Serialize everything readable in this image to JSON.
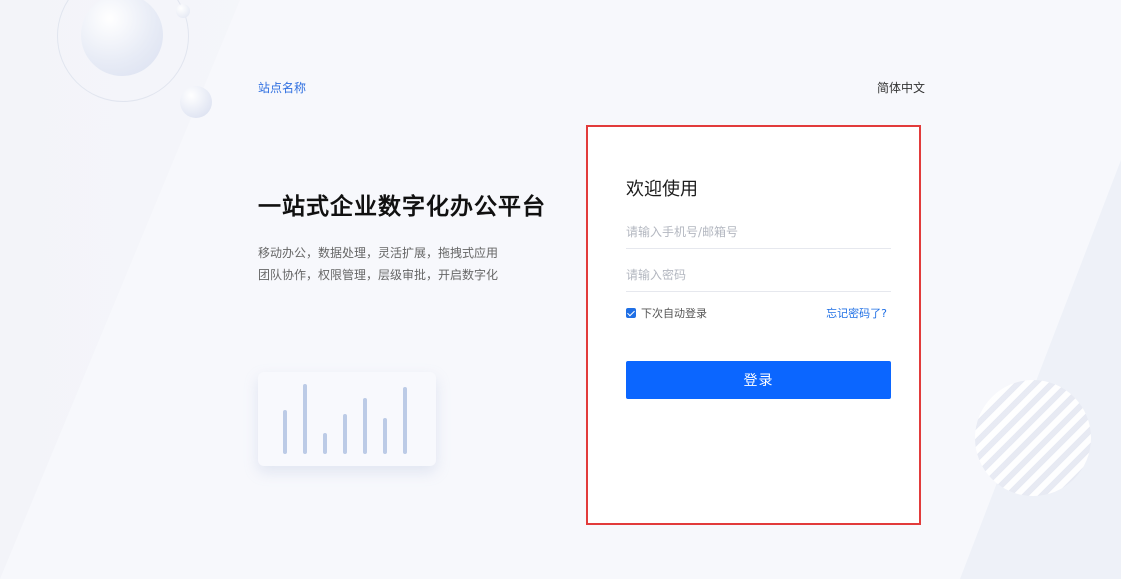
{
  "header": {
    "site_name": "站点名称",
    "language": "简体中文"
  },
  "hero": {
    "title": "一站式企业数字化办公平台",
    "line1": "移动办公，数据处理，灵活扩展，拖拽式应用",
    "line2": "团队协作，权限管理，层级审批，开启数字化"
  },
  "login": {
    "welcome": "欢迎使用",
    "phone_placeholder": "请输入手机号/邮箱号",
    "password_placeholder": "请输入密码",
    "remember_label": "下次自动登录",
    "remember_checked": true,
    "forgot_label": "忘记密码了?",
    "submit_label": "登录"
  },
  "colors": {
    "accent": "#0b66ff",
    "link": "#1f6fe5",
    "highlight_border": "#e23b3b"
  }
}
